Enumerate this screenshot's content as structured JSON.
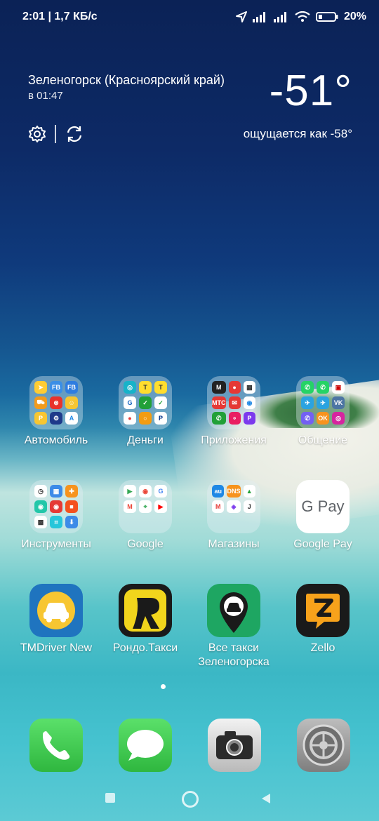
{
  "status": {
    "time_speed": "2:01 | 1,7 КБ/с",
    "battery": "20%"
  },
  "weather": {
    "city": "Зеленогорск (Красноярский край)",
    "updated": "в 01:47",
    "temperature": "-51°",
    "feels_like": "ощущается как -58°"
  },
  "apps": {
    "row1": [
      {
        "label": "Автомобиль"
      },
      {
        "label": "Деньги"
      },
      {
        "label": "Приложения"
      },
      {
        "label": "Общение"
      }
    ],
    "row2": [
      {
        "label": "Инструменты"
      },
      {
        "label": "Google"
      },
      {
        "label": "Магазины"
      },
      {
        "label": "Google Pay",
        "icon_text": "G Pay"
      }
    ],
    "row3": [
      {
        "label": "TMDriver New"
      },
      {
        "label": "Рондо.Такси"
      },
      {
        "label": "Все такси Зеленогорска"
      },
      {
        "label": "Zello"
      }
    ]
  },
  "dock": [
    "phone-icon",
    "messages-icon",
    "camera-icon",
    "settings-icon"
  ],
  "colors": {
    "taxi_yellow": "#f7c632",
    "zello_orange": "#f7a21b",
    "phone_green": "#3ecb4b"
  }
}
